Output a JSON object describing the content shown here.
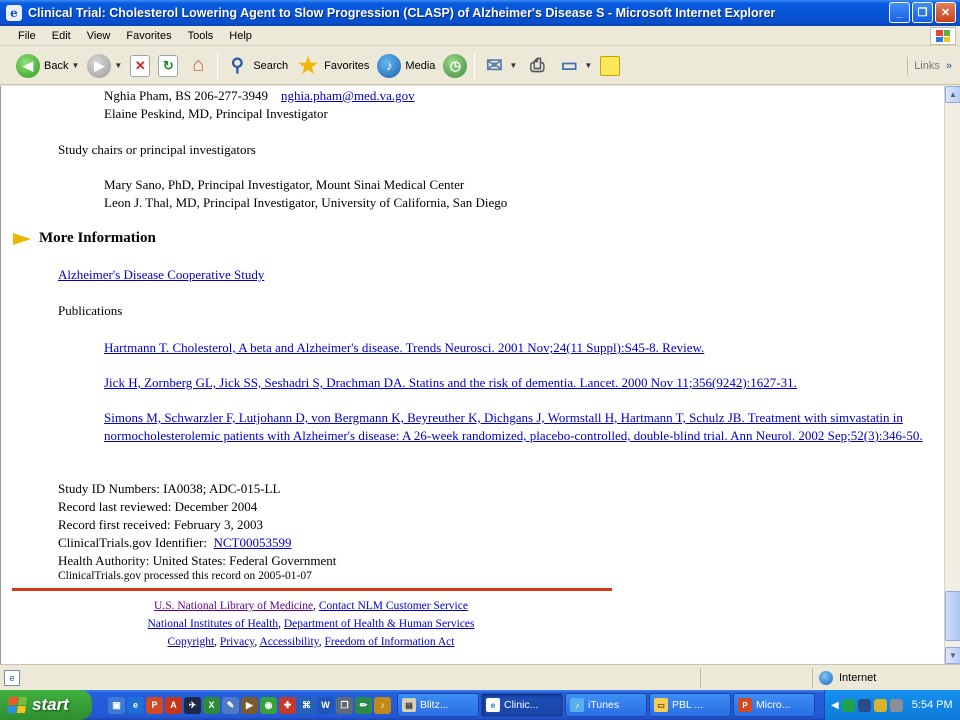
{
  "window": {
    "title": "Clinical Trial: Cholesterol Lowering Agent to Slow Progression (CLASP) of Alzheimer's Disease S - Microsoft Internet Explorer"
  },
  "menu": [
    "File",
    "Edit",
    "View",
    "Favorites",
    "Tools",
    "Help"
  ],
  "toolbar": {
    "back": "Back",
    "search": "Search",
    "favorites": "Favorites",
    "media": "Media",
    "links": "Links"
  },
  "page": {
    "contact_name": "Nghia Pham, BS  206-277-3949",
    "contact_email": "nghia.pham@med.va.gov",
    "contact2": "Elaine Peskind, MD,  Principal Investigator",
    "chairs_label": "Study chairs or principal investigators",
    "chair1": "Mary Sano, PhD,  Principal Investigator,  Mount Sinai Medical Center",
    "chair2": "Leon J. Thal, MD,  Principal Investigator,  University of California, San Diego",
    "more_info_title": "More Information",
    "adcs_link": "Alzheimer's Disease Cooperative Study",
    "publications_label": "Publications",
    "publications": [
      "Hartmann T. Cholesterol, A beta and Alzheimer's disease. Trends Neurosci. 2001 Nov;24(11 Suppl):S45-8. Review.",
      "Jick H, Zornberg GL, Jick SS, Seshadri S, Drachman DA. Statins and the risk of dementia. Lancet. 2000 Nov 11;356(9242):1627-31.",
      "Simons M, Schwarzler F, Lutjohann D, von Bergmann K, Beyreuther K, Dichgans J, Wormstall H, Hartmann T, Schulz JB. Treatment with simvastatin in normocholesterolemic patients with Alzheimer's disease: A 26-week randomized, placebo-controlled, double-blind trial. Ann Neurol. 2002 Sep;52(3):346-50."
    ],
    "study_id": "Study ID Numbers:  IA0038; ADC-015-LL",
    "last_reviewed": "Record last reviewed:  December 2004",
    "first_received": "Record first received:  February 3, 2003",
    "identifier_label": "ClinicalTrials.gov Identifier:",
    "identifier_link": "NCT00053599",
    "health_authority": "Health Authority: United States: Federal Government",
    "processed": "ClinicalTrials.gov processed this record on 2005-01-07"
  },
  "footer": {
    "nlm": "U.S. National Library of Medicine",
    "contact": "Contact NLM Customer Service",
    "nih": "National Institutes of Health",
    "hhs": "Department of Health & Human Services",
    "copyright": "Copyright",
    "privacy": "Privacy",
    "accessibility": "Accessibility",
    "foia": "Freedom of Information Act",
    "sep": ","
  },
  "status": {
    "zone": "Internet"
  },
  "taskbar": {
    "start": "start",
    "tasks": [
      "Blitz...",
      "Clinic...",
      "iTunes",
      "PBL ...",
      "Micro..."
    ],
    "clock": "5:54 PM"
  }
}
